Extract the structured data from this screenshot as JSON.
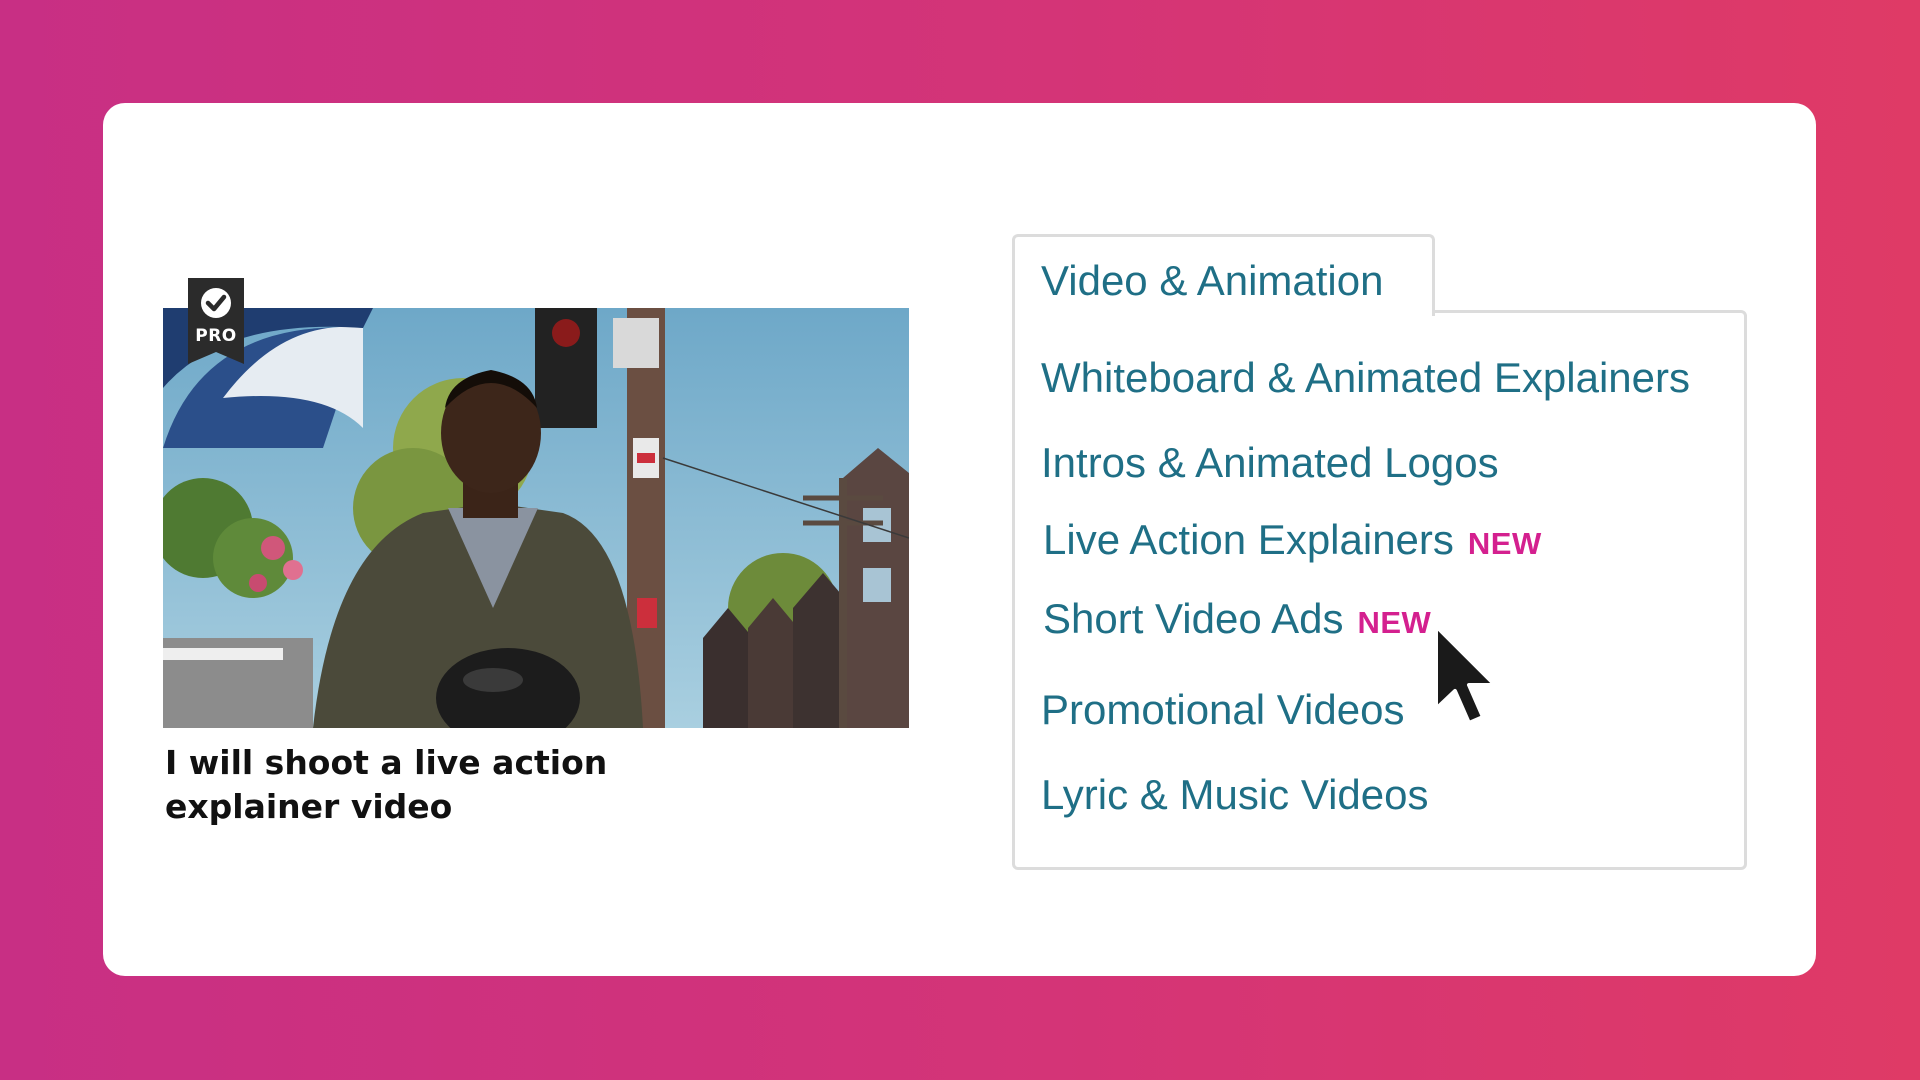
{
  "gig": {
    "badge_label": "PRO",
    "title": "I will shoot a live action explainer video"
  },
  "menu": {
    "tab_label": "Video & Animation",
    "items": [
      {
        "label": "Whiteboard & Animated Explainers",
        "badge": ""
      },
      {
        "label": "Intros & Animated Logos",
        "badge": ""
      },
      {
        "label": "Live Action Explainers",
        "badge": "NEW"
      },
      {
        "label": "Short Video Ads",
        "badge": "NEW"
      },
      {
        "label": "Promotional Videos",
        "badge": ""
      },
      {
        "label": "Lyric & Music Videos",
        "badge": ""
      }
    ]
  },
  "colors": {
    "background_start": "#c82f84",
    "background_end": "#df3a66",
    "link": "#1f6f86",
    "new_badge": "#d4208f"
  },
  "icons": {
    "pro_badge": "check-circle-icon",
    "cursor": "mouse-pointer-icon"
  }
}
